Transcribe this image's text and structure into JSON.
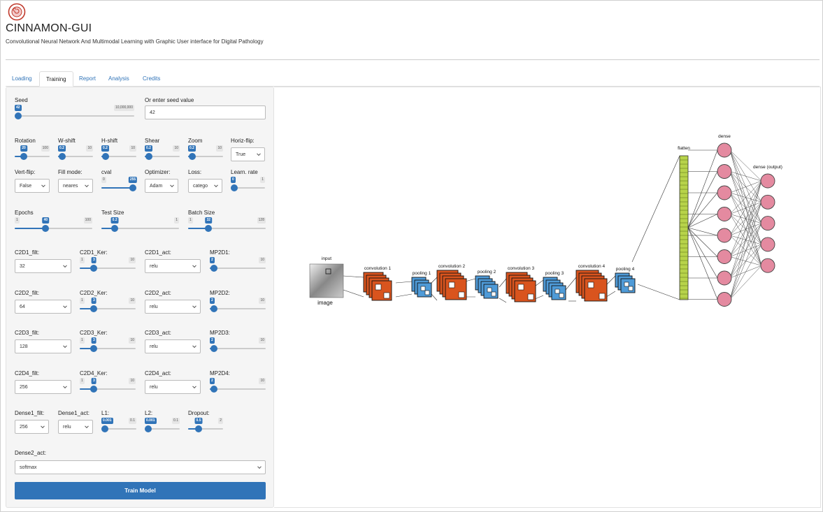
{
  "app": {
    "title": "CINNAMON-GUI",
    "subtitle": "Convolutional Neural Network And Multimodal Learning with Graphic User interface for Digital Pathology",
    "logo_icon": "cinnamon-roll-logo-icon"
  },
  "tabs": [
    {
      "label": "Loading",
      "active": false
    },
    {
      "label": "Training",
      "active": true
    },
    {
      "label": "Report",
      "active": false
    },
    {
      "label": "Analysis",
      "active": false
    },
    {
      "label": "Credits",
      "active": false
    }
  ],
  "colors": {
    "accent": "#3174b8",
    "conv": "#d9541e",
    "pool": "#4f9bd8",
    "flatten": "#b7d34a",
    "neuron": "#e48aa0"
  },
  "form": {
    "seed": {
      "label": "Seed",
      "value": "42",
      "min": "",
      "max": "10,000,000",
      "frac": 0
    },
    "seed_input": {
      "label": "Or enter seed value",
      "value": "42"
    },
    "rotation": {
      "label": "Rotation",
      "value": "20",
      "min": "",
      "max": "100",
      "frac": 0.2
    },
    "w_shift": {
      "label": "W-shift",
      "value": "0.2",
      "min": "",
      "max": "10",
      "frac": 0.02
    },
    "h_shift": {
      "label": "H-shift",
      "value": "0.2",
      "min": "",
      "max": "10",
      "frac": 0.02
    },
    "shear": {
      "label": "Shear",
      "value": "0.2",
      "min": "",
      "max": "10",
      "frac": 0.02
    },
    "zoom": {
      "label": "Zoom",
      "value": "0.2",
      "min": "",
      "max": "10",
      "frac": 0.02
    },
    "horiz_flip": {
      "label": "Horiz-flip:",
      "value": "True"
    },
    "vert_flip": {
      "label": "Vert-flip:",
      "value": "False"
    },
    "fill_mode": {
      "label": "Fill mode:",
      "value": "neares"
    },
    "cval": {
      "label": "cval",
      "value": "255",
      "min": "0",
      "max": "",
      "frac": 1
    },
    "optimizer": {
      "label": "Optimizer:",
      "value": "Adam"
    },
    "loss": {
      "label": "Loss:",
      "value": "catego"
    },
    "learn_rate": {
      "label": "Learn. rate",
      "value": "0",
      "min": "",
      "max": "1",
      "frac": 0
    },
    "epochs": {
      "label": "Epochs",
      "value": "40",
      "min": "1",
      "max": "100",
      "frac": 0.39
    },
    "test_size": {
      "label": "Test Size",
      "value": "0.2",
      "min": "",
      "max": "1",
      "frac": 0.14
    },
    "batch_size": {
      "label": "Batch Size",
      "value": "32",
      "min": "1",
      "max": "128",
      "frac": 0.24
    },
    "layers": [
      {
        "filt_label": "C2D1_filt:",
        "filt": "32",
        "ker_label": "C2D1_Ker:",
        "ker": "3",
        "act_label": "C2D1_act:",
        "act": "relu",
        "mp_label": "MP2D1:",
        "mp": "2"
      },
      {
        "filt_label": "C2D2_filt:",
        "filt": "64",
        "ker_label": "C2D2_Ker:",
        "ker": "3",
        "act_label": "C2D2_act:",
        "act": "relu",
        "mp_label": "MP2D2:",
        "mp": "2"
      },
      {
        "filt_label": "C2D3_filt:",
        "filt": "128",
        "ker_label": "C2D3_Ker:",
        "ker": "3",
        "act_label": "C2D3_act:",
        "act": "relu",
        "mp_label": "MP2D3:",
        "mp": "2"
      },
      {
        "filt_label": "C2D4_filt:",
        "filt": "256",
        "ker_label": "C2D4_Ker:",
        "ker": "3",
        "act_label": "C2D4_act:",
        "act": "relu",
        "mp_label": "MP2D4:",
        "mp": "2"
      }
    ],
    "ker_range": {
      "min": "1",
      "max": "10",
      "frac": 0.22
    },
    "mp_range": {
      "min": "",
      "max": "10",
      "frac": 0.02
    },
    "dense1_filt": {
      "label": "Dense1_filt:",
      "value": "256"
    },
    "dense1_act": {
      "label": "Dense1_act:",
      "value": "relu"
    },
    "l1": {
      "label": "L1:",
      "value": "0.001",
      "min": "",
      "max": "0.1",
      "frac": 0
    },
    "l2": {
      "label": "L2:",
      "value": "0.001",
      "min": "",
      "max": "0.1",
      "frac": 0
    },
    "dropout": {
      "label": "Dropout:",
      "value": "0.5",
      "min": "",
      "max": "2",
      "frac": 0.25
    },
    "dense2_act": {
      "label": "Dense2_act:",
      "value": "softmax"
    },
    "train_button": "Train Model"
  },
  "network_diagram": {
    "input_label": "input",
    "image_label": "image",
    "layer_labels": [
      "convolution 1",
      "pooling 1",
      "convolution 2",
      "pooling 2",
      "convolution 3",
      "pooling 3",
      "convolution 4",
      "pooling 4"
    ],
    "flatten_label": "flatten",
    "dense_label": "dense",
    "output_label": "dense (output)",
    "dense_neurons": 8,
    "output_neurons": 5
  }
}
